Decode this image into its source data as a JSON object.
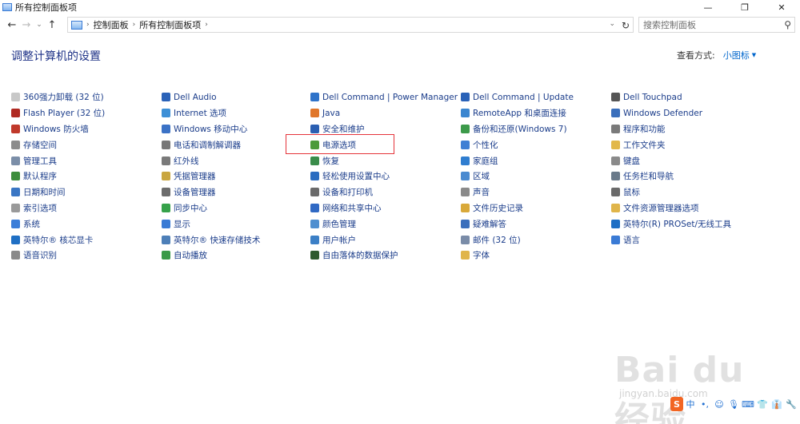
{
  "window": {
    "title": "所有控制面板项",
    "controls": [
      "—",
      "❐",
      "✕"
    ]
  },
  "nav": {
    "back": "←",
    "forward": "→",
    "recent": "⌄",
    "up": "↑"
  },
  "breadcrumb": [
    "控制面板",
    "所有控制面板项"
  ],
  "search": {
    "placeholder": "搜索控制面板"
  },
  "header": {
    "title": "调整计算机的设置",
    "view_by_label": "查看方式:",
    "view_by_value": "小图标"
  },
  "columns": [
    [
      {
        "label": "360强力卸载 (32 位)",
        "icon": "uninstall-icon",
        "color": "#c8c8c8"
      },
      {
        "label": "Flash Player (32 位)",
        "icon": "flash-icon",
        "color": "#b02a22"
      },
      {
        "label": "Windows 防火墙",
        "icon": "firewall-icon",
        "color": "#c0392b"
      },
      {
        "label": "存储空间",
        "icon": "storage-icon",
        "color": "#8c8c8c"
      },
      {
        "label": "管理工具",
        "icon": "admin-tools-icon",
        "color": "#7b8ea8"
      },
      {
        "label": "默认程序",
        "icon": "default-programs-icon",
        "color": "#3c8d3c"
      },
      {
        "label": "日期和时间",
        "icon": "datetime-icon",
        "color": "#3a76c4"
      },
      {
        "label": "索引选项",
        "icon": "indexing-icon",
        "color": "#9a9a9a"
      },
      {
        "label": "系统",
        "icon": "system-icon",
        "color": "#3b7dd8"
      },
      {
        "label": "英特尔® 核芯显卡",
        "icon": "intel-graphics-icon",
        "color": "#1f6fc4"
      },
      {
        "label": "语音识别",
        "icon": "microphone-icon",
        "color": "#8a8a8a"
      }
    ],
    [
      {
        "label": "Dell Audio",
        "icon": "dell-audio-icon",
        "color": "#2a62b8"
      },
      {
        "label": "Internet 选项",
        "icon": "internet-icon",
        "color": "#3d8fd6"
      },
      {
        "label": "Windows 移动中心",
        "icon": "mobility-icon",
        "color": "#3b72c6"
      },
      {
        "label": "电话和调制解调器",
        "icon": "phone-modem-icon",
        "color": "#777777"
      },
      {
        "label": "红外线",
        "icon": "infrared-icon",
        "color": "#7a7a7a"
      },
      {
        "label": "凭据管理器",
        "icon": "credential-icon",
        "color": "#c9a640"
      },
      {
        "label": "设备管理器",
        "icon": "device-manager-icon",
        "color": "#6c6c6c"
      },
      {
        "label": "同步中心",
        "icon": "sync-icon",
        "color": "#36a24a"
      },
      {
        "label": "显示",
        "icon": "display-icon",
        "color": "#3a7bd5"
      },
      {
        "label": "英特尔® 快速存储技术",
        "icon": "intel-storage-icon",
        "color": "#4d7fb8"
      },
      {
        "label": "自动播放",
        "icon": "autoplay-icon",
        "color": "#3a9a48"
      }
    ],
    [
      {
        "label": "Dell Command | Power Manager",
        "icon": "dell-power-icon",
        "color": "#2f73c9"
      },
      {
        "label": "Java",
        "icon": "java-icon",
        "color": "#e0762a"
      },
      {
        "label": "安全和维护",
        "icon": "security-flag-icon",
        "color": "#2b5fb2"
      },
      {
        "label": "电源选项",
        "icon": "power-options-icon",
        "color": "#4c9a3a"
      },
      {
        "label": "恢复",
        "icon": "recovery-icon",
        "color": "#3a8c4a"
      },
      {
        "label": "轻松使用设置中心",
        "icon": "ease-of-access-icon",
        "color": "#2a6cc0"
      },
      {
        "label": "设备和打印机",
        "icon": "printer-icon",
        "color": "#6a6a6a"
      },
      {
        "label": "网络和共享中心",
        "icon": "network-icon",
        "color": "#3069c4"
      },
      {
        "label": "颜色管理",
        "icon": "color-management-icon",
        "color": "#4f8fd0"
      },
      {
        "label": "用户帐户",
        "icon": "user-accounts-icon",
        "color": "#3b7fc6"
      },
      {
        "label": "自由落体的数据保护",
        "icon": "freefall-icon",
        "color": "#2f5a2f"
      }
    ],
    [
      {
        "label": "Dell Command | Update",
        "icon": "dell-update-icon",
        "color": "#2a62b8"
      },
      {
        "label": "RemoteApp 和桌面连接",
        "icon": "remoteapp-icon",
        "color": "#3a86d0"
      },
      {
        "label": "备份和还原(Windows 7)",
        "icon": "backup-icon",
        "color": "#3c9a4a"
      },
      {
        "label": "个性化",
        "icon": "personalization-icon",
        "color": "#3f7fd4"
      },
      {
        "label": "家庭组",
        "icon": "homegroup-icon",
        "color": "#2f7dd0"
      },
      {
        "label": "区域",
        "icon": "region-icon",
        "color": "#4a8ad0"
      },
      {
        "label": "声音",
        "icon": "sound-icon",
        "color": "#8a8a8a"
      },
      {
        "label": "文件历史记录",
        "icon": "file-history-icon",
        "color": "#d9a93a"
      },
      {
        "label": "疑难解答",
        "icon": "troubleshoot-icon",
        "color": "#3a6fbc"
      },
      {
        "label": "邮件 (32 位)",
        "icon": "mail-icon",
        "color": "#7a8ca8"
      },
      {
        "label": "字体",
        "icon": "fonts-icon",
        "color": "#e0b54a"
      }
    ],
    [
      {
        "label": "Dell Touchpad",
        "icon": "touchpad-icon",
        "color": "#555555"
      },
      {
        "label": "Windows Defender",
        "icon": "defender-icon",
        "color": "#3a6fbc"
      },
      {
        "label": "程序和功能",
        "icon": "programs-icon",
        "color": "#7a7a7a"
      },
      {
        "label": "工作文件夹",
        "icon": "work-folders-icon",
        "color": "#e2b84a"
      },
      {
        "label": "键盘",
        "icon": "keyboard-icon",
        "color": "#8a8a8a"
      },
      {
        "label": "任务栏和导航",
        "icon": "taskbar-icon",
        "color": "#6a7a8a"
      },
      {
        "label": "鼠标",
        "icon": "mouse-icon",
        "color": "#6a6a6a"
      },
      {
        "label": "文件资源管理器选项",
        "icon": "explorer-options-icon",
        "color": "#e0b54a"
      },
      {
        "label": "英特尔(R) PROSet/无线工具",
        "icon": "intel-wireless-icon",
        "color": "#1f6fc4"
      },
      {
        "label": "语言",
        "icon": "language-icon",
        "color": "#3a7bd5"
      }
    ]
  ],
  "watermark": {
    "text": "Bai du 经验",
    "sub": "jingyan.baidu.com"
  },
  "ime_toolbar": [
    "S",
    "中",
    "•,",
    "☺",
    "🎙",
    "⌨",
    "👕",
    "👔",
    "🔧"
  ]
}
